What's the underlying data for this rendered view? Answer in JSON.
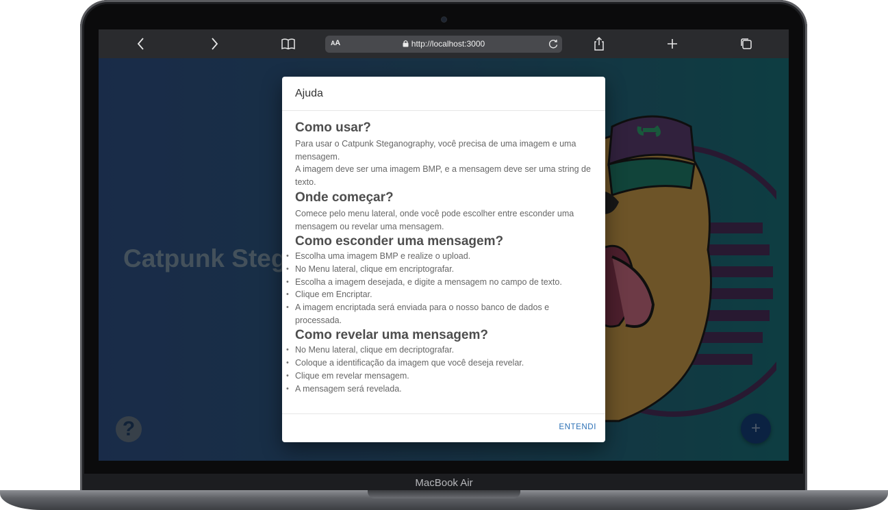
{
  "device": {
    "label": "MacBook Air"
  },
  "browser": {
    "text_size_label": "AA",
    "url": "http://localhost:3000",
    "icons": [
      "back-icon",
      "forward-icon",
      "bookmarks-icon",
      "lock-icon",
      "reload-icon",
      "share-icon",
      "new-tab-icon",
      "tabs-icon"
    ]
  },
  "page": {
    "hero_title": "Catpunk Steg",
    "help_button": "?",
    "add_button": "+"
  },
  "dialog": {
    "title": "Ajuda",
    "sections": [
      {
        "heading": "Como usar?",
        "paragraphs": [
          "Para usar o Catpunk Steganography, você precisa de uma imagem e uma mensagem.",
          "A imagem deve ser uma imagem BMP, e a mensagem deve ser uma string de texto."
        ]
      },
      {
        "heading": "Onde começar?",
        "paragraphs": [
          "Comece pelo menu lateral, onde você pode escolher entre esconder uma mensagem ou revelar uma mensagem."
        ]
      },
      {
        "heading": "Como esconder uma mensagem?",
        "items": [
          "Escolha uma imagem BMP e realize o upload.",
          "No Menu lateral, clique em encriptografar.",
          "Escolha a imagem desejada, e digite a mensagem no campo de texto.",
          "Clique em Encriptar.",
          "A imagem encriptada será enviada para o nosso banco de dados e processada."
        ]
      },
      {
        "heading": "Como revelar uma mensagem?",
        "items": [
          "No Menu lateral, clique em decriptografar.",
          "Coloque a identificação da imagem que você deseja revelar.",
          "Clique em revelar mensagem.",
          "A mensagem será revelada."
        ]
      }
    ],
    "confirm_label": "ENTENDI"
  },
  "colors": {
    "gradient_start": "#2f4f84",
    "gradient_end": "#1a7078",
    "link_blue": "#2a6fb5",
    "fab_blue": "#153f78"
  }
}
